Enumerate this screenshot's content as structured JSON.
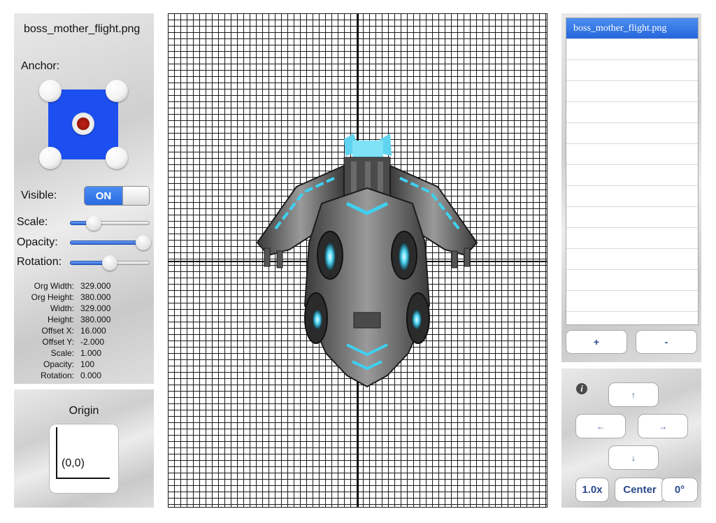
{
  "inspector": {
    "file_name": "boss_mother_flight.png",
    "anchor_label": "Anchor:",
    "visible_label": "Visible:",
    "visible_state": "ON",
    "scale_label": "Scale:",
    "opacity_label": "Opacity:",
    "rotation_label": "Rotation:",
    "scale_slider_fraction": 0.3,
    "opacity_slider_fraction": 0.92,
    "rotation_slider_fraction": 0.5,
    "stats": [
      {
        "label": "Org Width:",
        "value": "329.000"
      },
      {
        "label": "Org Height:",
        "value": "380.000"
      },
      {
        "label": "Width:",
        "value": "329.000"
      },
      {
        "label": "Height:",
        "value": "380.000"
      },
      {
        "label": "Offset X:",
        "value": "16.000"
      },
      {
        "label": "Offset Y:",
        "value": "-2.000"
      },
      {
        "label": "Scale:",
        "value": "1.000"
      },
      {
        "label": "Opacity:",
        "value": "100"
      },
      {
        "label": "Rotation:",
        "value": "0.000"
      }
    ]
  },
  "origin": {
    "title": "Origin",
    "coordinate": "(0,0)"
  },
  "sprite_list": {
    "items": [
      "boss_mother_flight.png"
    ],
    "add_label": "+",
    "remove_label": "-"
  },
  "controls": {
    "info_glyph": "i",
    "up": "↑",
    "left": "←",
    "right": "→",
    "down": "↓",
    "zoom": "1.0x",
    "center": "Center",
    "rotation": "0°"
  },
  "colors": {
    "anchor_box": "#1d4ff0",
    "toggle_on": "#2a6be0",
    "selected_row": "#2566dc",
    "ship_accent": "#3fd0f0"
  }
}
